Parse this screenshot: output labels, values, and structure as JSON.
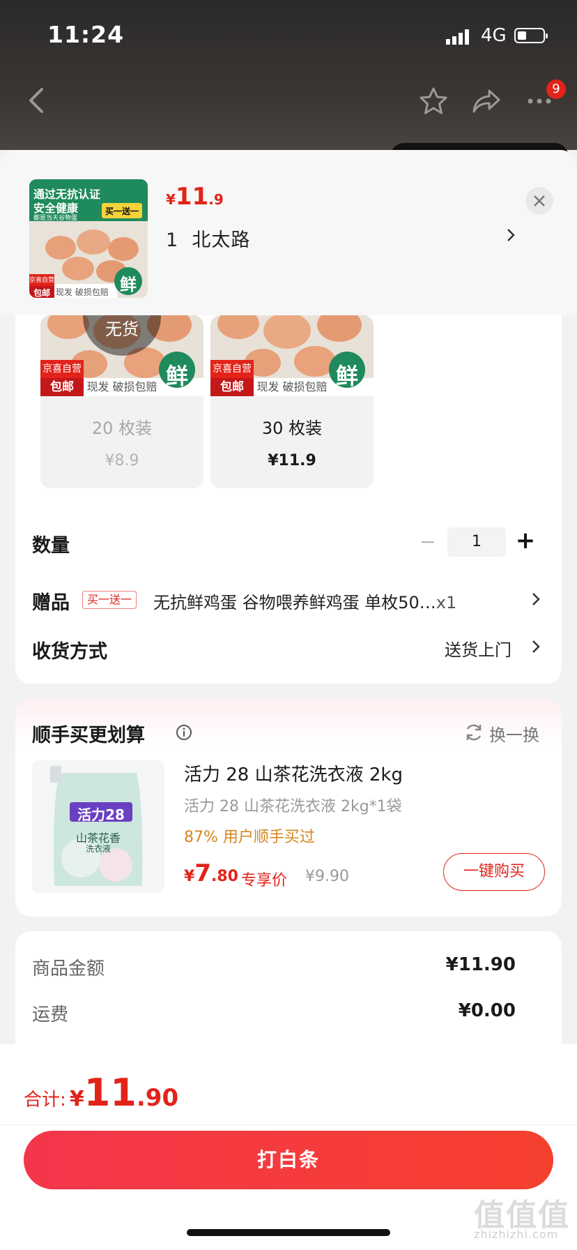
{
  "status_bar": {
    "time": "11:24",
    "network": "4G"
  },
  "nav": {
    "cart_badge": "9"
  },
  "header": {
    "price_symbol": "¥",
    "price_int": "11",
    "price_dec": ".9",
    "address_prefix": "1",
    "address": "北太路",
    "thumb": {
      "line1": "通过无抗认证",
      "line2": "安全健康",
      "line3": "都是当天谷物蛋",
      "tag": "买一送一",
      "self_run": "京喜自营",
      "free_ship": "包邮",
      "fresh": "鲜",
      "footer": "现发 破损包赔"
    }
  },
  "sku_options": [
    {
      "name": "20 枚装",
      "price": "¥8.9",
      "status": "无货",
      "self_run": "京喜自营",
      "free_ship": "包邮",
      "fresh": "鲜",
      "footer": "现发 破损包赔"
    },
    {
      "name": "30 枚装",
      "price": "¥11.9",
      "self_run": "京喜自营",
      "free_ship": "包邮",
      "fresh": "鲜",
      "footer": "现发 破损包赔"
    }
  ],
  "quantity": {
    "label": "数量",
    "value": "1",
    "minus": "−",
    "plus": "+"
  },
  "gift": {
    "label": "赠品",
    "tag": "买一送一",
    "text": "无抗鲜鸡蛋 谷物喂养鲜鸡蛋 单枚50…",
    "count": "x1"
  },
  "delivery": {
    "label": "收货方式",
    "value": "送货上门"
  },
  "addon": {
    "title": "顺手买更划算",
    "refresh": "换一换",
    "product_title": "活力 28 山茶花洗衣液 2kg",
    "product_sub": "活力 28 山茶花洗衣液 2kg*1袋",
    "percent_text": "87% 用户顺手买过",
    "price_symbol": "¥",
    "price_int": "7",
    "price_dec": ".80",
    "price_label": "专享价",
    "orig_price": "¥9.90",
    "buy_button": "一键购买",
    "img_brand": "活力28",
    "img_line1": "山茶花香",
    "img_line2": "洗衣液"
  },
  "summary": {
    "goods_label": "商品金额",
    "goods_value": "¥11.90",
    "shipping_label": "运费",
    "shipping_value": "¥0.00"
  },
  "total": {
    "label": "合计:",
    "symbol": "¥",
    "int": "11",
    "dec": ".90"
  },
  "pay_button": "打白条",
  "watermark": {
    "main": "值值值",
    "sub": "zhizhizhi.com"
  },
  "colors": {
    "accent": "#e2231a",
    "pay_gradient_start": "#f4364c",
    "pay_gradient_end": "#f6402e",
    "orange_text": "#d4861e"
  }
}
